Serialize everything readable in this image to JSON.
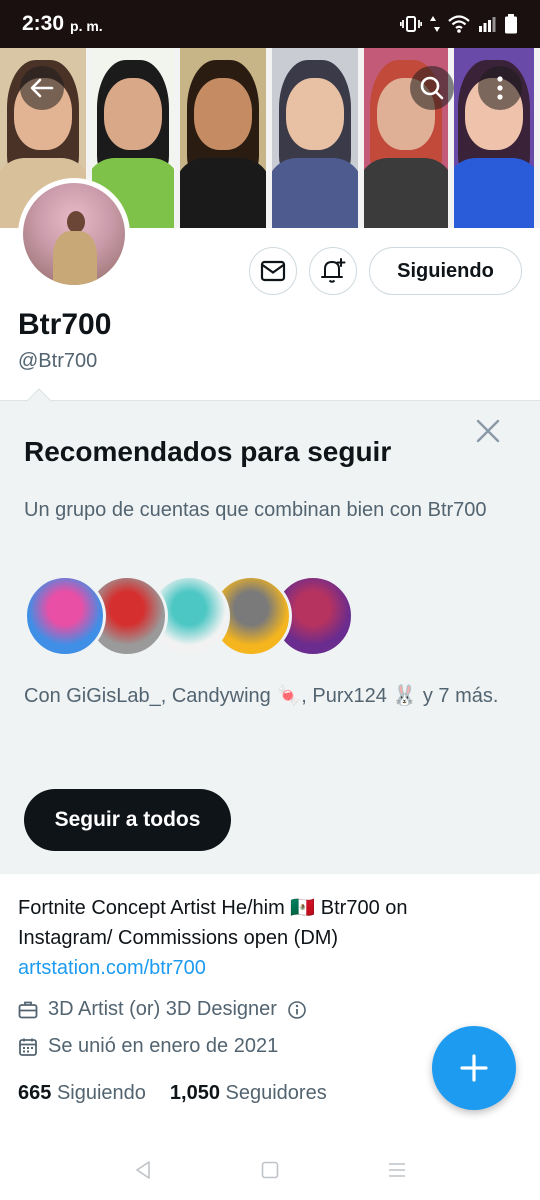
{
  "status_bar": {
    "time": "2:30",
    "ampm": "p. m."
  },
  "banner": {
    "panels": [
      {
        "bg": "#d9c6a4",
        "skin": "#e3b493",
        "hair": "#4a3226",
        "cloth": "#d7c09a"
      },
      {
        "bg": "#f2f4ee",
        "skin": "#d9a889",
        "hair": "#1b1b1b",
        "cloth": "#7ec24a"
      },
      {
        "bg": "#c7b487",
        "skin": "#c58b63",
        "hair": "#2b1c12",
        "cloth": "#1a1a1a"
      },
      {
        "bg": "#c9cdd3",
        "skin": "#e8c0a4",
        "hair": "#3a3a48",
        "cloth": "#4d5b8e"
      },
      {
        "bg": "#c25a78",
        "skin": "#e0b096",
        "hair": "#c24a3a",
        "cloth": "#3b3b3b"
      },
      {
        "bg": "#6a4aa8",
        "skin": "#efc2ab",
        "hair": "#3a2238",
        "cloth": "#2a5bd8"
      }
    ]
  },
  "profile": {
    "follow_button": "Siguiendo",
    "display_name": "Btr700",
    "handle": "@Btr700"
  },
  "recommended": {
    "title": "Recomendados para seguir",
    "description": "Un grupo de cuentas que combinan bien con Btr700",
    "avatars": [
      {
        "bg": "#3f8fe6",
        "accent": "#e84fa5"
      },
      {
        "bg": "#9a9a9a",
        "accent": "#d62f2f"
      },
      {
        "bg": "#f2f2f2",
        "accent": "#4cc7c4"
      },
      {
        "bg": "#f4b51e",
        "accent": "#7a7a7a"
      },
      {
        "bg": "#6a2c8e",
        "accent": "#b7335f"
      }
    ],
    "with_text": "Con GiGisLab_, Candywing 🍬, Purx124 🐰 y 7 más.",
    "follow_all": "Seguir a todos"
  },
  "bio": {
    "text": "Fortnite Concept Artist He/him 🇲🇽  Btr700 on Instagram/ Commissions open (DM)",
    "link": "artstation.com/btr700",
    "category": "3D Artist (or) 3D Designer",
    "joined": "Se unió en enero de 2021",
    "following_count": "665",
    "following_label": "Siguiendo",
    "followers_count": "1,050",
    "followers_label": "Seguidores"
  },
  "colors": {
    "accent": "#1d9bf0",
    "text_primary": "#0f1419",
    "text_secondary": "#536471",
    "reco_bg": "#eff3f4"
  },
  "icons": [
    "back-arrow-icon",
    "search-icon",
    "more-icon",
    "mail-icon",
    "bell-add-icon",
    "close-icon",
    "briefcase-icon",
    "info-icon",
    "calendar-icon",
    "plus-icon"
  ]
}
